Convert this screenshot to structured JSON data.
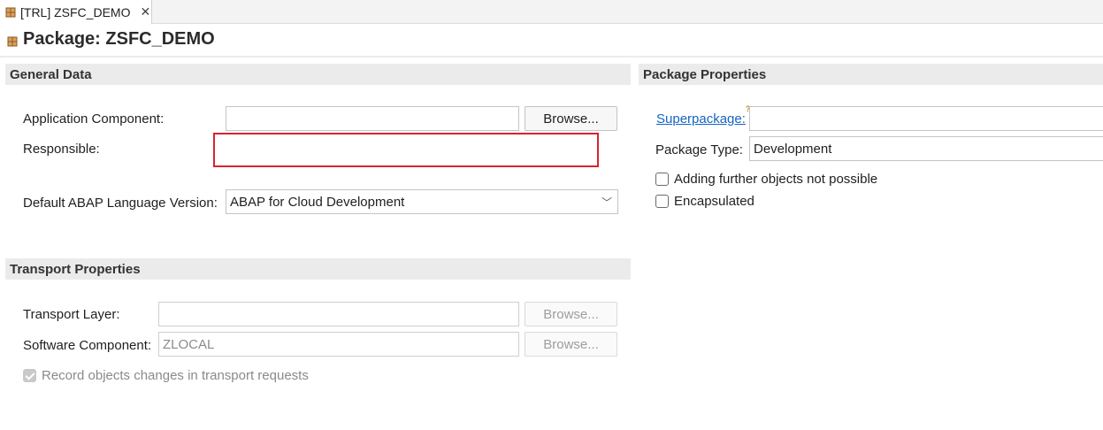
{
  "tab": {
    "label": "[TRL] ZSFC_DEMO",
    "close": "✕"
  },
  "editor": {
    "title": "Package: ZSFC_DEMO"
  },
  "general": {
    "header": "General Data",
    "app_component_label": "Application Component:",
    "app_component_value": "",
    "browse_label": "Browse...",
    "responsible_label": "Responsible:",
    "responsible_value": "",
    "language_label": "Default ABAP Language Version:",
    "language_value": "ABAP for Cloud Development",
    "chevron": "﹀"
  },
  "properties": {
    "header": "Package Properties",
    "superpackage_label": "Superpackage:",
    "superpackage_hint": "?",
    "superpackage_value": "",
    "package_type_label": "Package Type:",
    "package_type_value": "Development",
    "adding_objects_label": "Adding further objects not possible",
    "adding_objects_checked": false,
    "encapsulated_label": "Encapsulated",
    "encapsulated_checked": false
  },
  "transport": {
    "header": "Transport Properties",
    "layer_label": "Transport Layer:",
    "layer_value": "",
    "browse_label": "Browse...",
    "software_label": "Software Component:",
    "software_value": "ZLOCAL",
    "record_label": "Record objects changes in transport requests",
    "record_checked": true
  },
  "colors": {
    "highlight": "#d9232d",
    "link": "#1565c0",
    "section_bg": "#ebebeb"
  },
  "icons": {
    "package": "package-icon"
  }
}
